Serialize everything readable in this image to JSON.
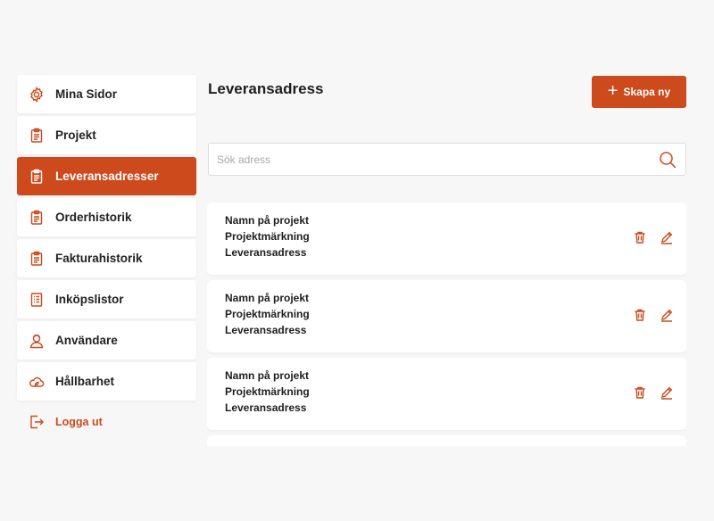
{
  "sidebar": {
    "items": [
      {
        "label": "Mina Sidor",
        "icon": "gear-icon",
        "active": false
      },
      {
        "label": "Projekt",
        "icon": "clipboard-icon",
        "active": false
      },
      {
        "label": "Leveransadresser",
        "icon": "clipboard-icon",
        "active": true
      },
      {
        "label": "Orderhistorik",
        "icon": "clipboard-icon",
        "active": false
      },
      {
        "label": "Fakturahistorik",
        "icon": "clipboard-icon",
        "active": false
      },
      {
        "label": "Inköpslistor",
        "icon": "list-document-icon",
        "active": false
      },
      {
        "label": "Användare",
        "icon": "user-icon",
        "active": false
      },
      {
        "label": "Hållbarhet",
        "icon": "eco-cloud-icon",
        "active": false
      }
    ],
    "logout_label": "Logga ut"
  },
  "main": {
    "title": "Leveransadress",
    "create_label": "Skapa ny",
    "search_placeholder": "Sök adress",
    "cards": [
      {
        "name": "Namn på projekt",
        "marking": "Projektmärkning",
        "address": "Leveransadress"
      },
      {
        "name": "Namn på projekt",
        "marking": "Projektmärkning",
        "address": "Leveransadress"
      },
      {
        "name": "Namn på projekt",
        "marking": "Projektmärkning",
        "address": "Leveransadress"
      }
    ]
  },
  "colors": {
    "accent": "#cc4a1c",
    "background": "#f7f7f7"
  }
}
